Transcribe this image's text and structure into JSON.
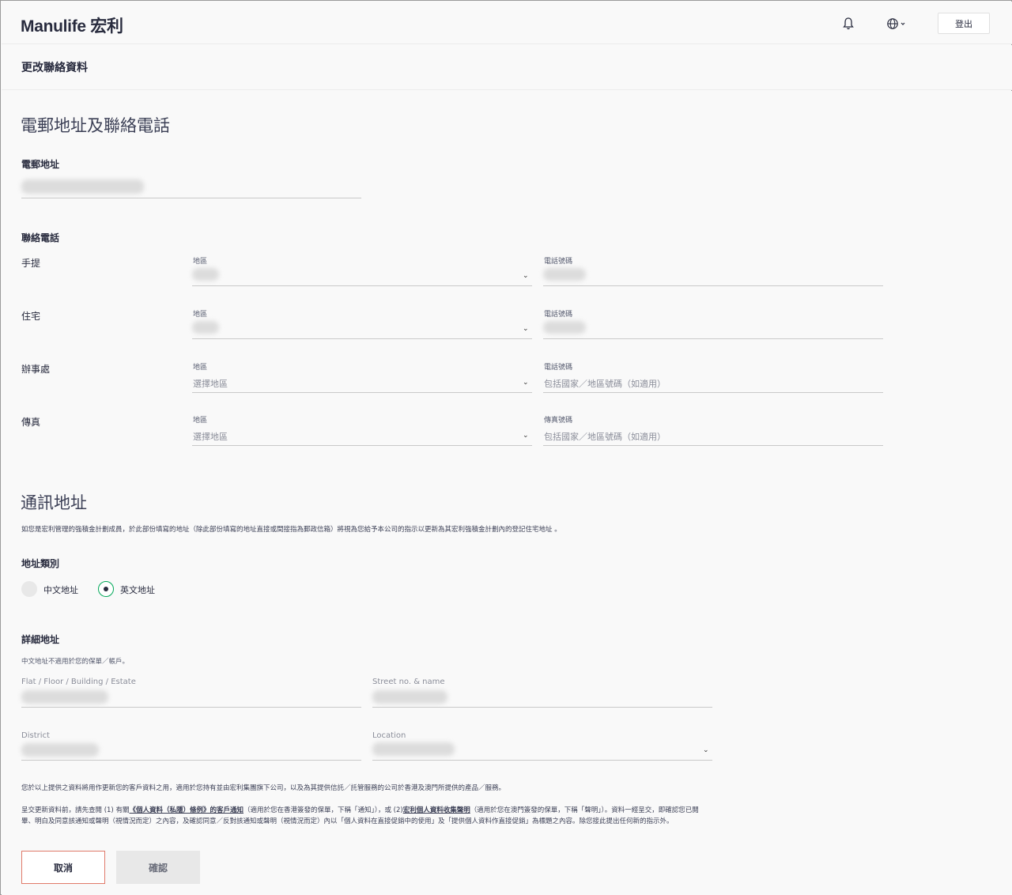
{
  "header": {
    "logo": "Manulife 宏利",
    "logout_label": "登出"
  },
  "page": {
    "title": "更改聯絡資料"
  },
  "contact": {
    "section_title": "電郵地址及聯絡電話",
    "email_label": "電郵地址",
    "phone_group_label": "聯絡電話",
    "rows": [
      {
        "label": "手提",
        "region_label": "地區",
        "region_value": "",
        "number_label": "電話號碼",
        "number_value": ""
      },
      {
        "label": "住宅",
        "region_label": "地區",
        "region_value": "",
        "number_label": "電話號碼",
        "number_value": ""
      },
      {
        "label": "辦事處",
        "region_label": "地區",
        "region_placeholder": "選擇地區",
        "number_label": "電話號碼",
        "number_placeholder": "包括國家／地區號碼（如適用）"
      },
      {
        "label": "傳真",
        "region_label": "地區",
        "region_placeholder": "選擇地區",
        "number_label": "傳真號碼",
        "number_placeholder": "包括國家／地區號碼（如適用）"
      }
    ]
  },
  "address": {
    "section_title": "通訊地址",
    "note": "如您是宏利管理的強積金計劃成員，於此部份填寫的地址（除此部份填寫的地址直接或間接指為郵政信箱）將視為您給予本公司的指示以更新為其宏利強積金計劃內的登記住宅地址 。",
    "type_label": "地址類別",
    "options": [
      {
        "label": "中文地址",
        "selected": false
      },
      {
        "label": "英文地址",
        "selected": true
      }
    ],
    "detail_label": "詳細地址",
    "detail_note": "中文地址不適用於您的保單／帳戶。",
    "fields": {
      "flat": "Flat / Floor / Building / Estate",
      "street": "Street no. & name",
      "district": "District",
      "location": "Location"
    }
  },
  "disclaimer": {
    "line1": "您於以上提供之資料將用作更新您的客戶資料之用，適用於您持有並由宏利集團旗下公司，以及為其提供信託／託管服務的公司於香港及澳門所提供的產品／服務。",
    "line2_a": "呈交更新資料前，請先查閱 (1) 有關",
    "line2_link1": "《個人資料（私隱）條例》的客戶通知",
    "line2_b": "（適用於您在香港簽發的保單，下稱「通知」），或 (2)",
    "line2_link2": "宏利個人資料收集聲明",
    "line2_c": "（適用於您在澳門簽發的保單，下稱「聲明」）。資料一經呈交，即確認您已閱",
    "line3": "畢、明白及同意該通知或聲明（視情況而定）之內容，及確認同意／反對該通知或聲明（視情況而定）內以「個人資料在直接促銷中的使用」及「提供個人資料作直接促銷」為標題之內容。除您接此提出任何新的指示外。"
  },
  "actions": {
    "cancel": "取消",
    "confirm": "確認"
  },
  "colors": {
    "brand_green": "#00a758",
    "cancel_border": "#e07a6a",
    "text_dark": "#282b3e"
  }
}
